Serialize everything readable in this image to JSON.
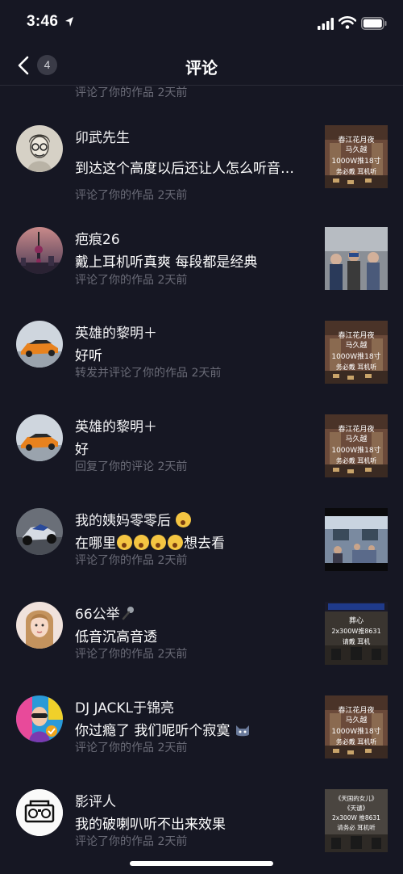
{
  "status_bar": {
    "time": "3:46"
  },
  "nav": {
    "badge_count": "4",
    "title": "评论"
  },
  "partial_top_meta": "评论了你的作品  2天前",
  "comments": [
    {
      "username": "卯武先生",
      "content": "到达这个高度以后还让人怎么听音…",
      "meta": "评论了你的作品  2天前"
    },
    {
      "username": "疤痕26",
      "content": "戴上耳机听真爽 每段都是经典",
      "meta": "评论了你的作品  2天前"
    },
    {
      "username": "英雄的黎明＋",
      "content": "好听",
      "meta": "转发并评论了你的作品  2天前"
    },
    {
      "username": "英雄的黎明＋",
      "content": "好",
      "meta": "回复了你的评论  2天前"
    },
    {
      "username": "我的姨妈零零后",
      "content_before": "在哪里",
      "content_after": "想去看",
      "meta": "评论了你的作品  2天前"
    },
    {
      "username": "66公举",
      "content": "低音沉高音透",
      "meta": "评论了你的作品  2天前"
    },
    {
      "username": "DJ JACKL于锦亮",
      "content": "你过瘾了 我们呢听个寂寞",
      "meta": "评论了你的作品  2天前"
    },
    {
      "username": "影评人",
      "content": "我的破喇叭听不出来效果",
      "meta": "评论了你的作品  2天前"
    }
  ],
  "thumbnails": {
    "event_poster": {
      "lines": [
        "春江花月夜",
        "马久越",
        "1000W推18寸",
        "务必戴  耳机听"
      ]
    },
    "poster_b": {
      "lines": [
        "葬心",
        "2x300W推8631",
        "请戴  耳机"
      ]
    },
    "poster_c": {
      "lines": [
        "《天国的女儿》",
        "《天谴》",
        "2x300W 推8631",
        "请务必  耳机听"
      ]
    }
  },
  "colors": {
    "background": "#161723",
    "meta_gray": "#6a6b77",
    "divider": "#2a2b37"
  }
}
